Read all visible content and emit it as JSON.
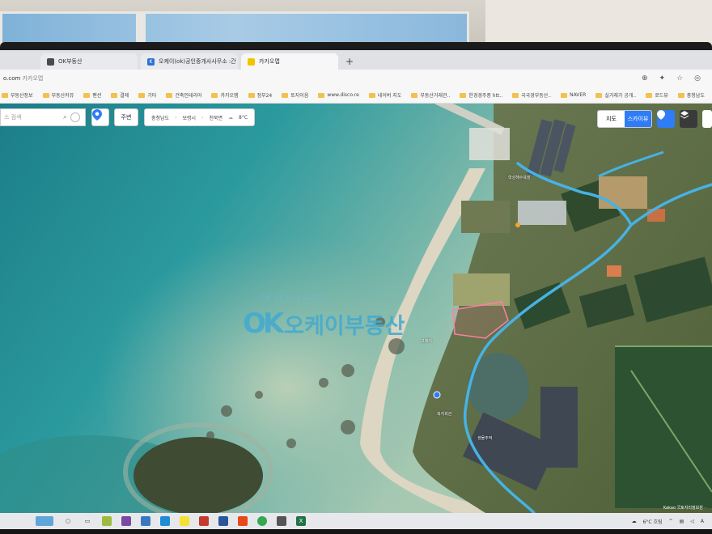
{
  "browser": {
    "tabs": [
      {
        "label": "OK부동산",
        "icon_color": "#4a4a4a",
        "icon_glyph": "",
        "active": false
      },
      {
        "label": "오케이(ok)공인중개사사무소 :간",
        "icon_color": "#2f6fd6",
        "icon_glyph": "K",
        "active": false
      },
      {
        "label": "카카오맵",
        "icon_color": "#f2c400",
        "icon_glyph": "",
        "active": true
      }
    ],
    "new_tab": "+",
    "url_host": "o.com",
    "url_title": "카카오맵",
    "bookmarks": [
      "부동산정보",
      "부동산커뮤",
      "펜션",
      "결제",
      "기타",
      "건축인테리어",
      "카카오맵",
      "정부24",
      "토지이음",
      "www.disco.re",
      "네이버 지도",
      "부동산거래관..",
      "한경경주중 htt..",
      "국국경부동산..",
      "NAVER",
      "실거래가 공개..",
      "로드뷰",
      "충청남도"
    ]
  },
  "map": {
    "search_placeholder": "스 검색",
    "nearby": "주변",
    "breadcrumb": [
      "충청남도",
      "보령시",
      "천북면"
    ],
    "weather": "8°C",
    "map_type": {
      "normal": "지도",
      "satellite": "스카이뷰",
      "active": "satellite"
    },
    "labels": [
      "학성해수욕장",
      "그레이",
      "복지회관",
      "생물추적"
    ],
    "watermark": {
      "badge": "OK",
      "text": "오케이부동산",
      "sub": "OK REAL ESTATE"
    },
    "copyright": "Kakao 국토지리정보원 ·"
  },
  "taskbar": {
    "tray_temp": "6°C 흐림",
    "tray_lang": "A"
  }
}
